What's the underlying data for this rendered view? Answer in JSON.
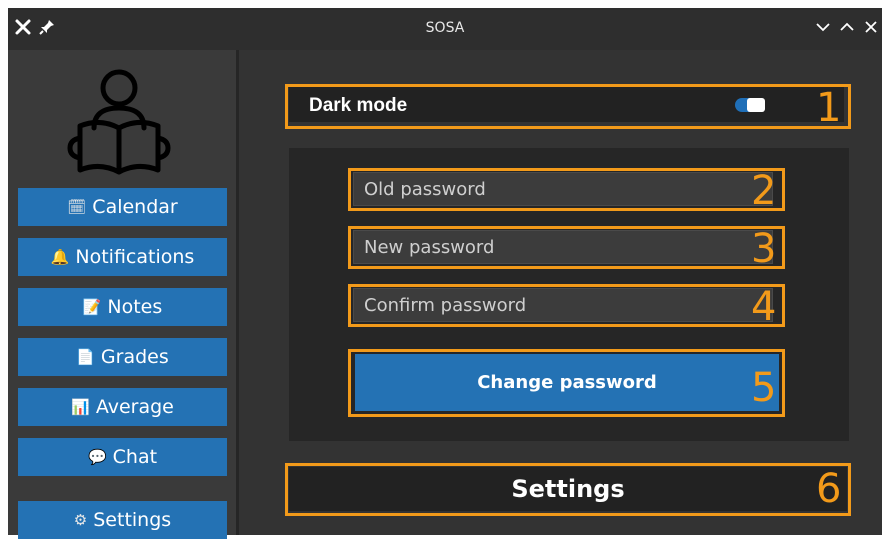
{
  "window": {
    "title": "SOSA",
    "buttons": [
      "close-icon",
      "pin-icon",
      "minimize-icon",
      "maximize-icon",
      "close-window-icon"
    ]
  },
  "sidebar": {
    "logo": "reader-icon",
    "items": [
      {
        "label": "Calendar",
        "icon": "🗓"
      },
      {
        "label": "Notifications",
        "icon": "🔔"
      },
      {
        "label": "Notes",
        "icon": "📝"
      },
      {
        "label": "Grades",
        "icon": "📄"
      },
      {
        "label": "Average",
        "icon": "📊"
      },
      {
        "label": "Chat",
        "icon": "💬"
      },
      {
        "label": "Settings",
        "icon": "⚙"
      }
    ]
  },
  "settings": {
    "dark_mode_label": "Dark mode",
    "dark_mode_on": true,
    "old_password_placeholder": "Old password",
    "new_password_placeholder": "New password",
    "confirm_password_placeholder": "Confirm password",
    "change_password_label": "Change password",
    "footer_title": "Settings"
  },
  "annotations": [
    "1",
    "2",
    "3",
    "4",
    "5",
    "6"
  ],
  "colors": {
    "accent": "#2472b4",
    "annotation": "#f29a1a",
    "background": "#333333"
  }
}
